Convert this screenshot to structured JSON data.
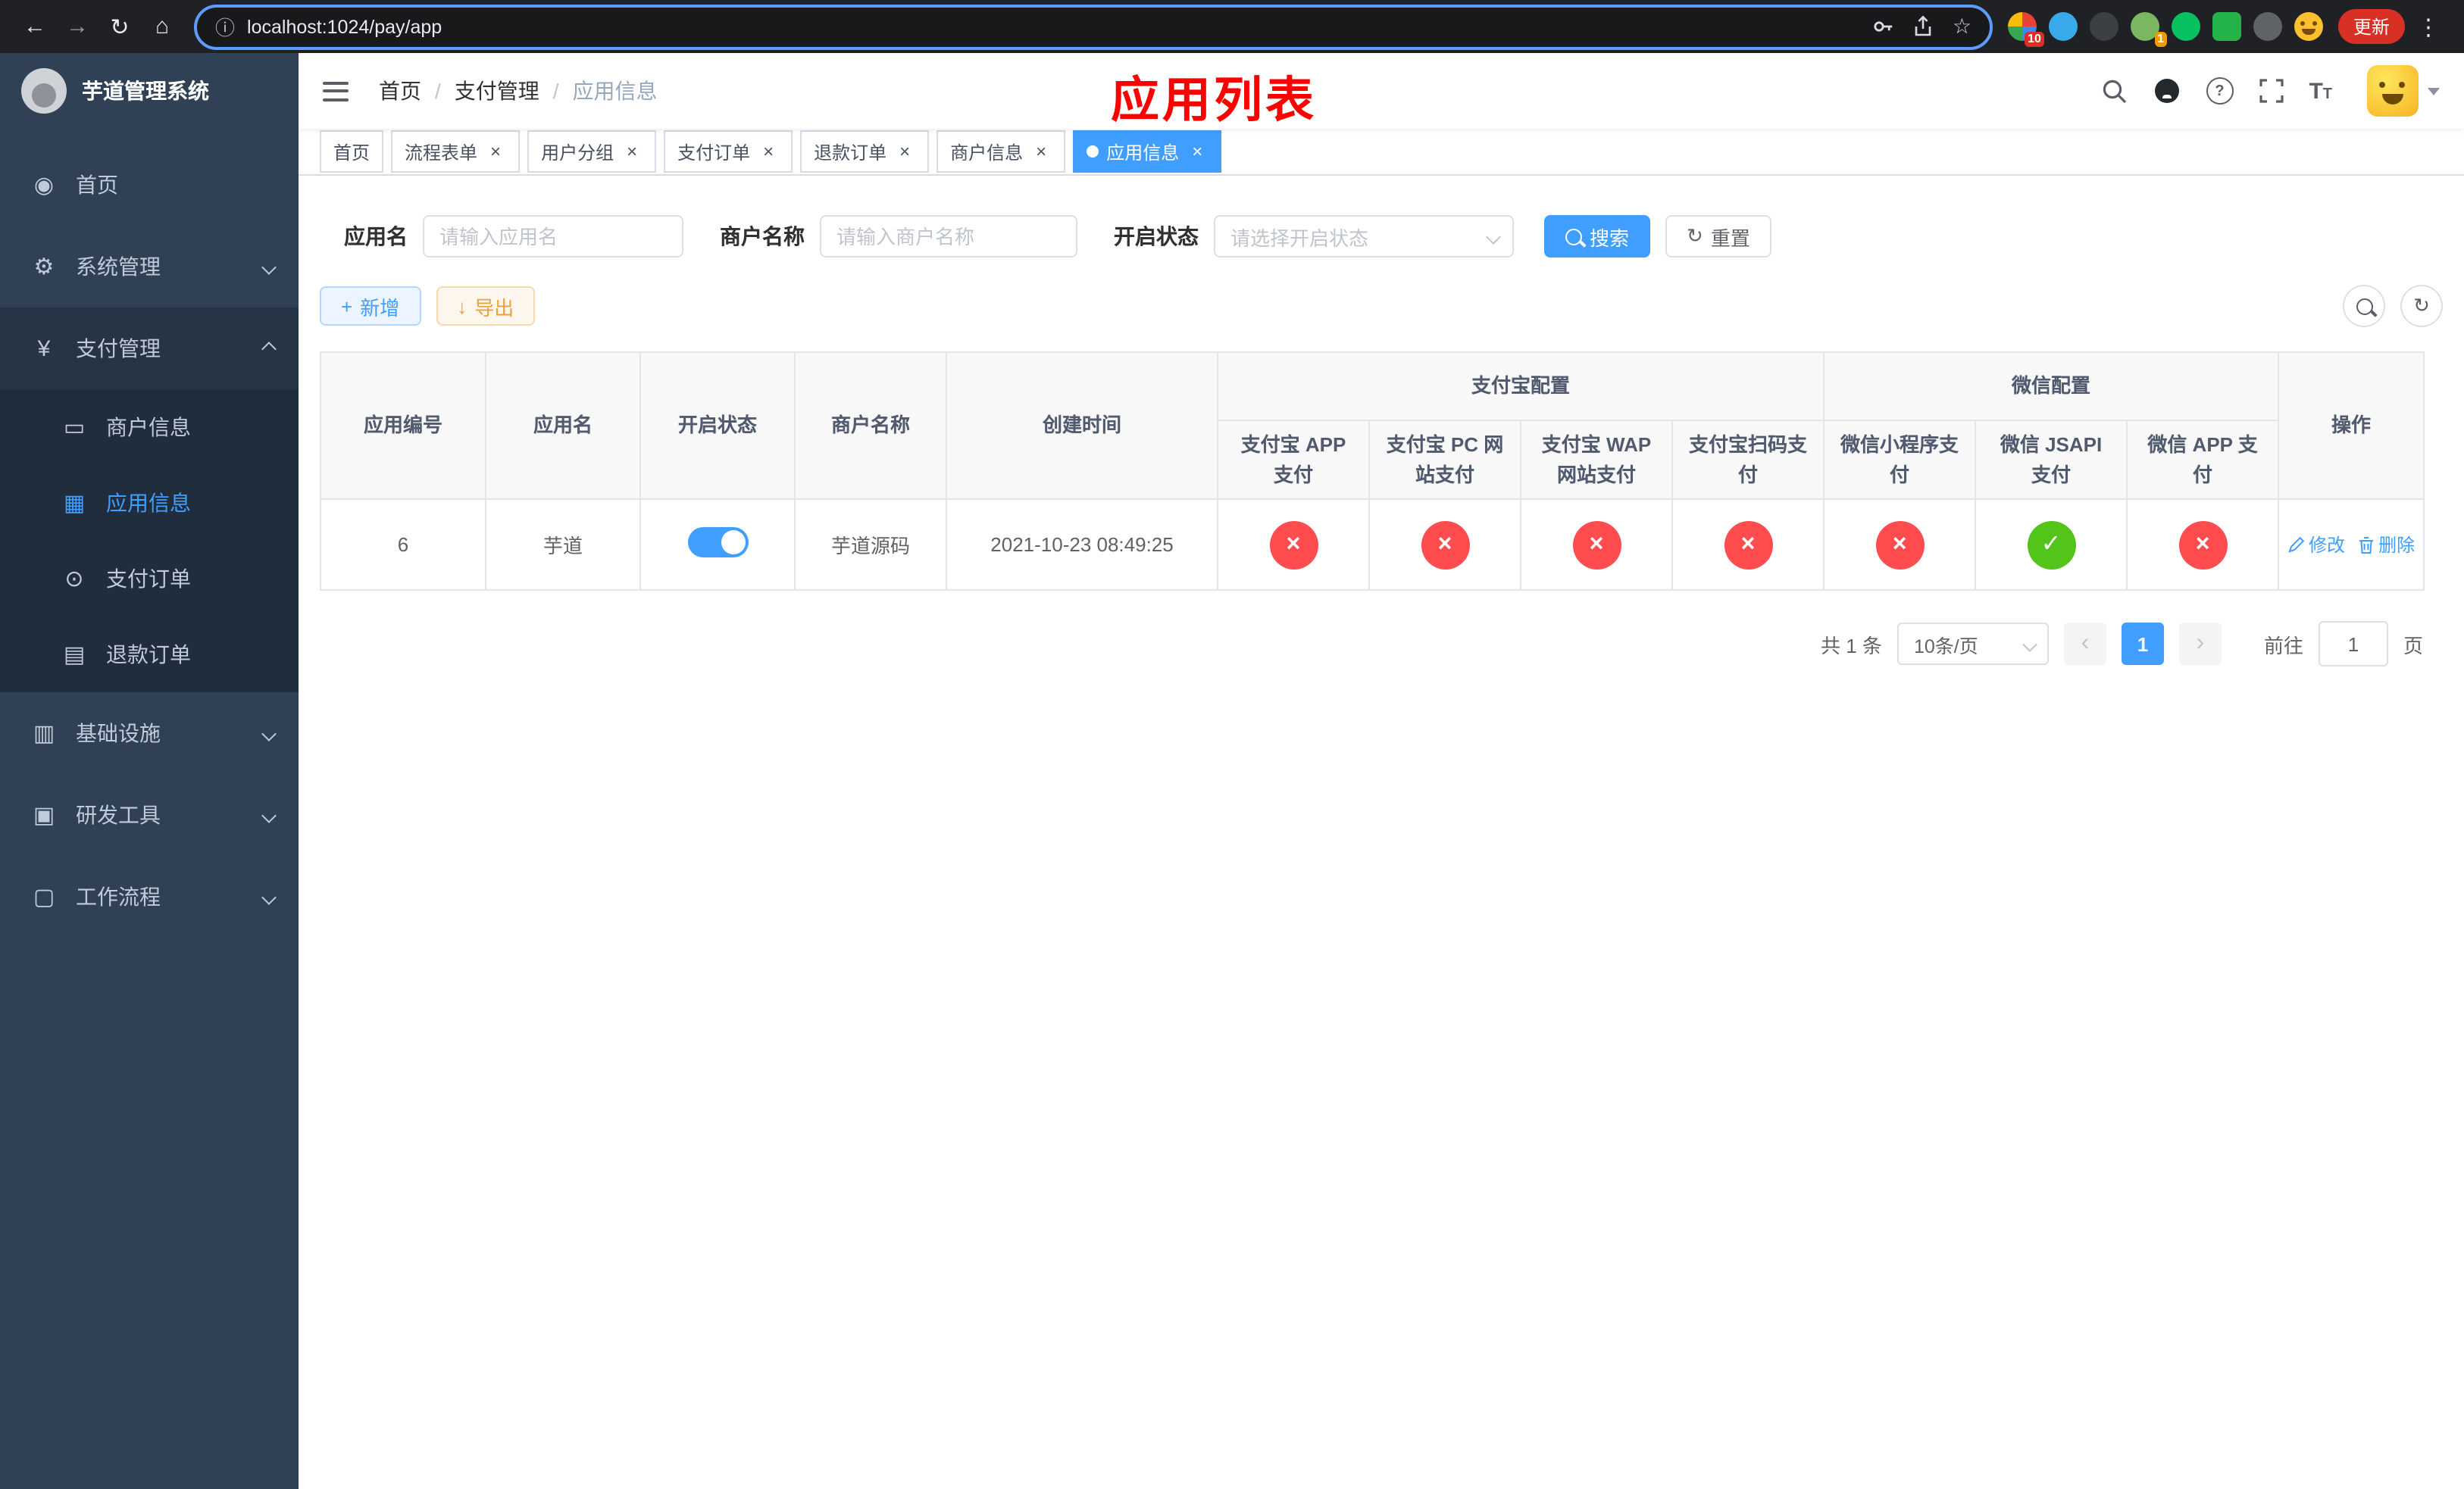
{
  "browser": {
    "url": "localhost:1024/pay/app",
    "update_label": "更新",
    "ext_badge_1": "10",
    "ext_badge_2": "1"
  },
  "sidebar": {
    "title": "芋道管理系统",
    "items": [
      {
        "label": "首页"
      },
      {
        "label": "系统管理"
      },
      {
        "label": "支付管理",
        "children": [
          {
            "label": "商户信息"
          },
          {
            "label": "应用信息"
          },
          {
            "label": "支付订单"
          },
          {
            "label": "退款订单"
          }
        ]
      },
      {
        "label": "基础设施"
      },
      {
        "label": "研发工具"
      },
      {
        "label": "工作流程"
      }
    ]
  },
  "navbar": {
    "breadcrumb": [
      "首页",
      "支付管理",
      "应用信息"
    ],
    "annotation": "应用列表"
  },
  "tabs": [
    {
      "label": "首页"
    },
    {
      "label": "流程表单"
    },
    {
      "label": "用户分组"
    },
    {
      "label": "支付订单"
    },
    {
      "label": "退款订单"
    },
    {
      "label": "商户信息"
    },
    {
      "label": "应用信息"
    }
  ],
  "filters": {
    "app_name_label": "应用名",
    "app_name_placeholder": "请输入应用名",
    "merchant_label": "商户名称",
    "merchant_placeholder": "请输入商户名称",
    "status_label": "开启状态",
    "status_placeholder": "请选择开启状态",
    "search_button": "搜索",
    "reset_button": "重置"
  },
  "toolbar": {
    "add_button": "新增",
    "export_button": "导出"
  },
  "table": {
    "headers": {
      "id": "应用编号",
      "name": "应用名",
      "status": "开启状态",
      "merchant": "商户名称",
      "created": "创建时间",
      "alipay_group": "支付宝配置",
      "wechat_group": "微信配置",
      "alipay_app": "支付宝 APP 支付",
      "alipay_pc": "支付宝 PC 网站支付",
      "alipay_wap": "支付宝 WAP 网站支付",
      "alipay_qr": "支付宝扫码支付",
      "wx_mini": "微信小程序支付",
      "wx_jsapi": "微信 JSAPI 支付",
      "wx_app": "微信 APP 支付",
      "actions": "操作"
    },
    "rows": [
      {
        "id": "6",
        "name": "芋道",
        "status_on": true,
        "merchant": "芋道源码",
        "created": "2021-10-23 08:49:25",
        "configs": [
          "no",
          "no",
          "no",
          "no",
          "no",
          "yes",
          "no"
        ],
        "edit": "修改",
        "delete": "删除"
      }
    ]
  },
  "pagination": {
    "total": "共 1 条",
    "page_size": "10条/页",
    "page": "1",
    "goto": "前往",
    "goto_value": "1",
    "unit": "页"
  },
  "colors": {
    "accent": "#409eff",
    "danger": "#ff4d4f",
    "success": "#52c41a",
    "sidebar_bg": "#304156"
  }
}
